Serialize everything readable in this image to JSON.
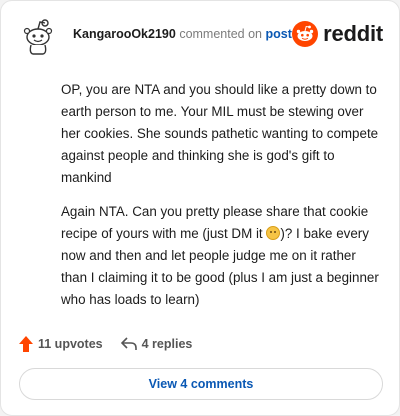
{
  "header": {
    "username": "KangarooOk2190",
    "action_text": "commented on",
    "post_link_text": "post",
    "brand_name": "reddit",
    "avatar_icon": "snoo-avatar-icon",
    "brand_color": "#ff4500"
  },
  "comment": {
    "paragraph1": "OP, you are NTA and you should like a pretty down to earth person to me. Your MIL must be stewing over her cookies. She sounds pathetic wanting to compete against people and thinking she is god's gift to mankind",
    "paragraph2_before_emoji": "Again NTA. Can you pretty please share that cookie recipe of yours with me (just DM it ",
    "paragraph2_after_emoji": ")? I bake every now and then and let people judge me on it rather than I claiming it to be good (plus I am just a beginner who has loads to learn)"
  },
  "footer": {
    "upvotes_label": "11 upvotes",
    "replies_label": "4 replies"
  },
  "actions": {
    "view_comments_label": "View 4 comments"
  }
}
